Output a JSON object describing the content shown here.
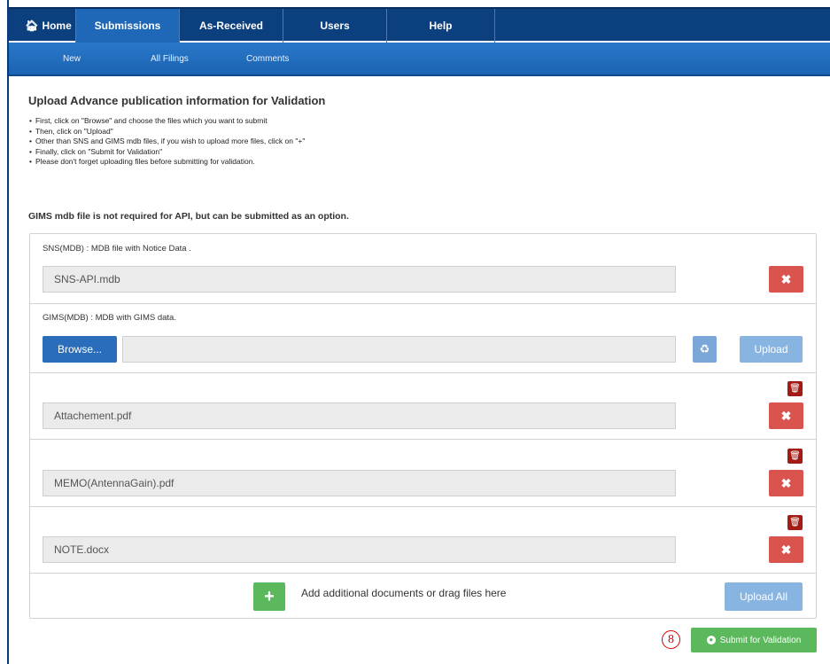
{
  "nav": {
    "tabs": [
      {
        "label": "Home",
        "icon": "home-icon"
      },
      {
        "label": "Submissions"
      },
      {
        "label": "As-Received"
      },
      {
        "label": "Users"
      },
      {
        "label": "Help"
      }
    ],
    "subtabs": [
      "New",
      "All Filings",
      "Comments"
    ]
  },
  "page": {
    "title": "Upload Advance publication information for Validation",
    "instructions": [
      "First, click on \"Browse\" and choose the files which you want to submit",
      "Then, click on \"Upload\"",
      "Other than SNS and GIMS mdb files, if you wish to upload more files, click on \"+\"",
      "Finally, click on \"Submit for Validation\"",
      "Please don't forget uploading files before submitting for validation."
    ],
    "note": "GIMS mdb file is not required for API, but can be submitted as an option."
  },
  "sns": {
    "label": "SNS(MDB) : MDB file with Notice Data .",
    "filename": "SNS-API.mdb",
    "remove": "✖"
  },
  "gims": {
    "label": "GIMS(MDB) : MDB with GIMS data.",
    "browse": "Browse...",
    "filename": "",
    "reset_icon": "♻",
    "upload": "Upload"
  },
  "attachments": [
    {
      "filename": "Attachement.pdf",
      "trash": "🗑",
      "remove": "✖"
    },
    {
      "filename": "MEMO(AntennaGain).pdf",
      "trash": "🗑",
      "remove": "✖"
    },
    {
      "filename": "NOTE.docx",
      "trash": "🗑",
      "remove": "✖"
    }
  ],
  "footer_row": {
    "add": "+",
    "add_text": "Add additional documents or drag files here",
    "upload_all": "Upload All"
  },
  "step_marker": "8",
  "submit": {
    "label": "Submit for Validation",
    "icon": "globe-icon"
  },
  "colors": {
    "nav": "#0b3f7e",
    "nav_active": "#1f67b7",
    "danger": "#d9534f",
    "primary": "#2a6ebb",
    "success": "#5cb85c",
    "trash": "#a31b14"
  }
}
